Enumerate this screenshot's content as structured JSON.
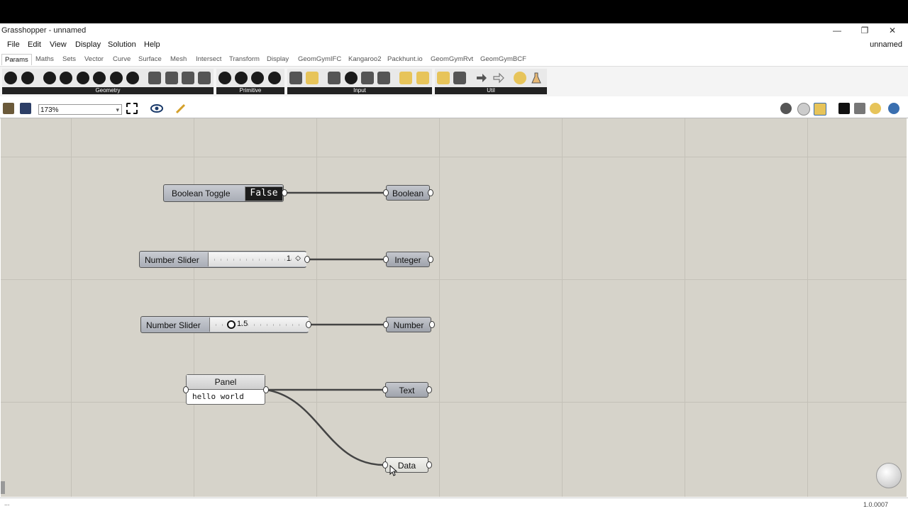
{
  "window": {
    "title": "Grasshopper - unnamed",
    "document": "unnamed"
  },
  "window_controls": {
    "minimize": "—",
    "restore": "❐",
    "close": "✕"
  },
  "menu": [
    "File",
    "Edit",
    "View",
    "Display",
    "Solution",
    "Help"
  ],
  "tabs": [
    "Params",
    "Maths",
    "Sets",
    "Vector",
    "Curve",
    "Surface",
    "Mesh",
    "Intersect",
    "Transform",
    "Display",
    "GeomGymIFC",
    "Kangaroo2",
    "Packhunt.io",
    "GeomGymRvt",
    "GeomGymBCF"
  ],
  "ribbon_groups": [
    "Geometry",
    "Primitive",
    "Input",
    "Util"
  ],
  "toolbar": {
    "zoom": "173%"
  },
  "nodes": {
    "boolean_toggle": {
      "label": "Boolean Toggle",
      "value": "False"
    },
    "slider_int": {
      "label": "Number Slider",
      "value": "1"
    },
    "slider_num": {
      "label": "Number Slider",
      "value": "1.5"
    },
    "panel": {
      "label": "Panel",
      "text": "hello world"
    },
    "p_boolean": "Boolean",
    "p_integer": "Integer",
    "p_number": "Number",
    "p_text": "Text",
    "p_data": "Data"
  },
  "status": {
    "left": "...",
    "version": "1.0.0007"
  },
  "colors": {
    "canvas": "#d6d3ca",
    "grid": "#c4c1b8",
    "wire": "#444444",
    "node": "#b0b3bb"
  }
}
